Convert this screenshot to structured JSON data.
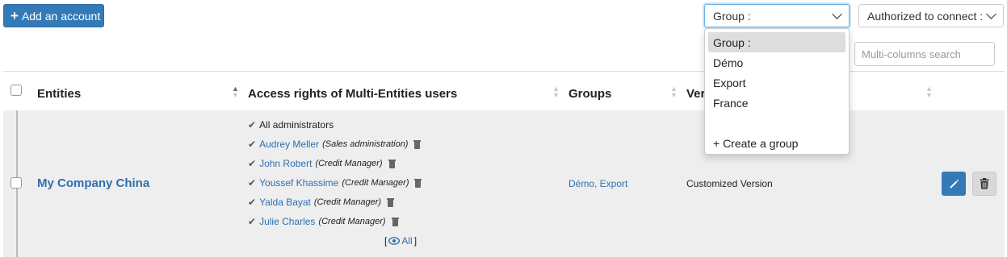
{
  "toolbar": {
    "add_account_label": "Add an account",
    "group_filter_value": "Group :",
    "authorized_filter_value": "Authorized to connect :",
    "search_placeholder": "Multi-columns search"
  },
  "group_dropdown": {
    "options": [
      "Group :",
      "Démo",
      "Export",
      "France"
    ],
    "create_label": "+ Create a group"
  },
  "table": {
    "headers": {
      "entities": "Entities",
      "access_rights": "Access rights of Multi-Entities users",
      "groups": "Groups",
      "version": "Ver"
    },
    "row": {
      "entity_name": "My Company China",
      "all_admins": "All administrators",
      "users": [
        {
          "name": "Audrey Meller",
          "role": "(Sales administration)"
        },
        {
          "name": "John Robert",
          "role": "(Credit Manager)"
        },
        {
          "name": "Youssef Khassime",
          "role": "(Credit Manager)"
        },
        {
          "name": "Yalda Bayat",
          "role": "(Credit Manager)"
        },
        {
          "name": "Julie Charles",
          "role": "(Credit Manager)"
        }
      ],
      "all_link_open": "[",
      "all_link_label": "All",
      "all_link_close": "]",
      "groups": "Démo, Export",
      "version": "Customized Version"
    }
  },
  "colors": {
    "primary": "#337ab7",
    "link": "#2f6fae",
    "row_bg": "#eeeeee"
  }
}
